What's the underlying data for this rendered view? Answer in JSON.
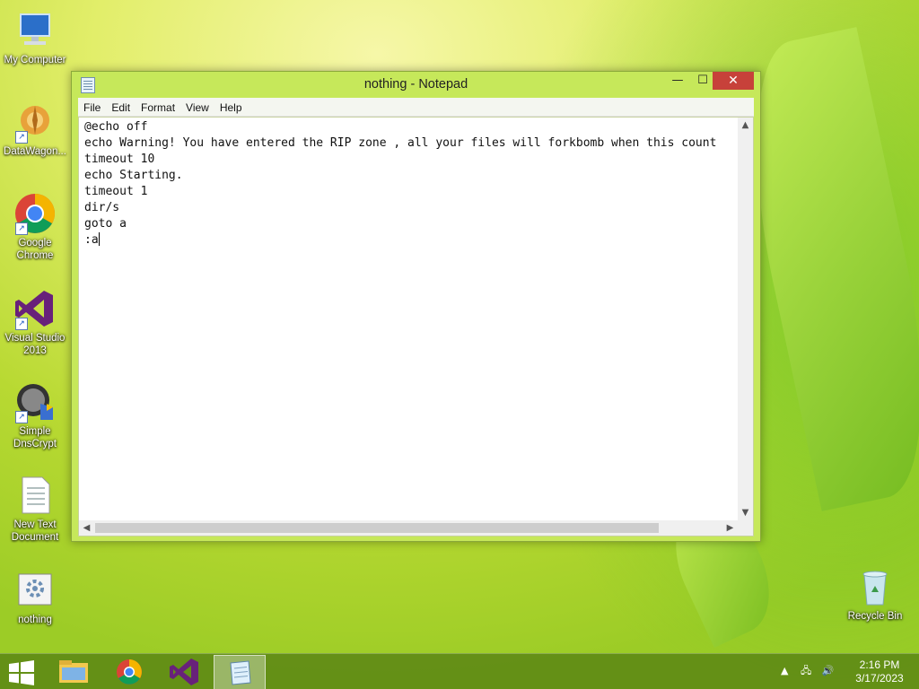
{
  "desktop": {
    "icons": [
      {
        "label": "My Computer",
        "icon": "computer-icon"
      },
      {
        "label": "DataWagon...",
        "icon": "datawagon-icon"
      },
      {
        "label": "Google Chrome",
        "icon": "chrome-icon"
      },
      {
        "label": "Visual Studio 2013",
        "icon": "visual-studio-icon"
      },
      {
        "label": "Simple DnsCrypt",
        "icon": "dnscrypt-icon"
      },
      {
        "label": "New Text Document",
        "icon": "text-document-icon"
      },
      {
        "label": "nothing",
        "icon": "batch-file-icon"
      },
      {
        "label": "Recycle Bin",
        "icon": "recycle-bin-icon"
      }
    ]
  },
  "window": {
    "title": "nothing - Notepad",
    "controls": {
      "minimize": "—",
      "maximize": "☐",
      "close": "✕"
    },
    "menu": [
      "File",
      "Edit",
      "Format",
      "View",
      "Help"
    ],
    "content_lines": [
      "@echo off",
      "echo Warning! You have entered the RIP zone , all your files will forkbomb when this count",
      "timeout 10",
      "echo Starting.",
      "timeout 1",
      "dir/s",
      "goto a",
      ":a"
    ]
  },
  "taskbar": {
    "apps": [
      "start-icon",
      "file-explorer-icon",
      "chrome-icon",
      "visual-studio-icon",
      "notepad-icon"
    ],
    "active_app": "notepad-icon",
    "clock": {
      "time": "2:16 PM",
      "date": "3/17/2023"
    }
  }
}
